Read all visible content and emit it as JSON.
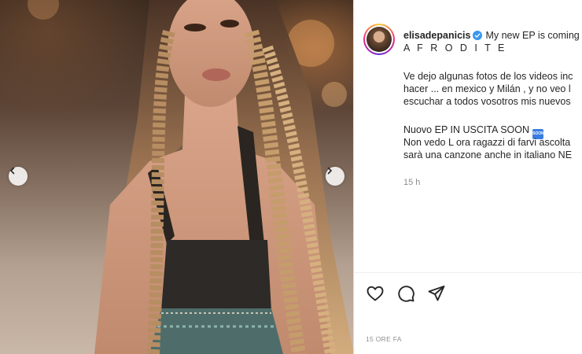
{
  "post": {
    "username": "elisadepanicis",
    "caption_lines": [
      "My new EP is coming",
      "A F R O D I T E",
      "",
      "Ve dejo algunas fotos de los videos inc",
      "hacer ... en mexico y Milán , y no veo l",
      "escuchar a todos vosotros mis nuevos",
      "",
      "Nuovo EP IN USCITA SOON",
      "Non vedo L ora ragazzi di farvi ascolta",
      "sarà una canzone anche in italiano NE"
    ],
    "soon_badge_text": "SOON",
    "time_relative": "15 h",
    "time_absolute": "15 ORE FA"
  },
  "icons": {
    "verified": "verified-badge-icon",
    "prev": "chevron-left-icon",
    "next": "chevron-right-icon",
    "like": "heart-icon",
    "comment": "comment-bubble-icon",
    "share": "paper-plane-icon"
  },
  "colors": {
    "verified_blue": "#3897f0",
    "text": "#262626",
    "muted": "#8e8e8e"
  }
}
